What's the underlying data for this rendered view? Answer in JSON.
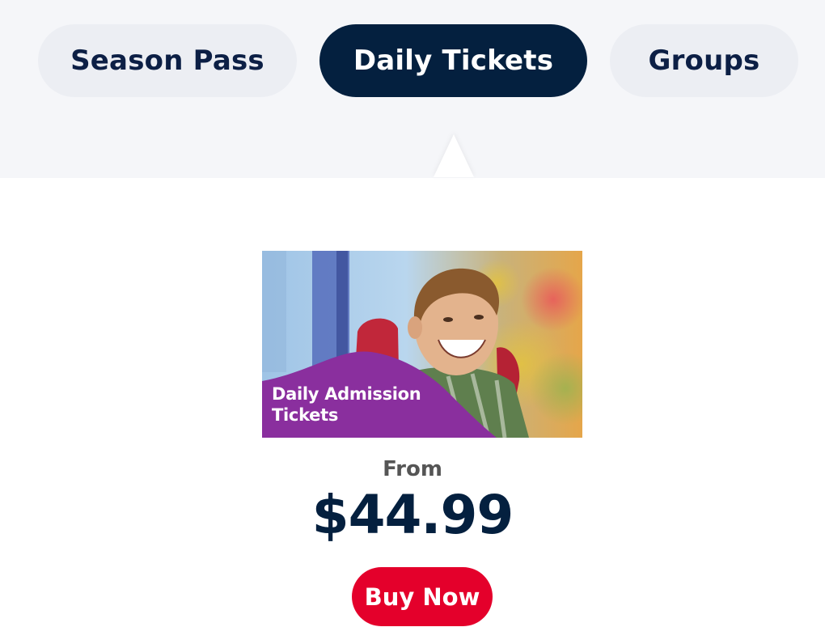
{
  "tabs": [
    {
      "label": "Season Pass",
      "active": false
    },
    {
      "label": "Daily Tickets",
      "active": true
    },
    {
      "label": "Groups",
      "active": false
    }
  ],
  "product": {
    "image_caption_line1": "Daily Admission",
    "image_caption_line2": "Tickets",
    "from_label": "From",
    "price": "$44.99",
    "buy_label": "Buy Now"
  },
  "colors": {
    "navy": "#04203f",
    "tab_inactive_bg": "#eceef3",
    "tab_bar_bg": "#f5f6f9",
    "buy_red": "#e4002b",
    "caption_purple": "#8a2f9e"
  }
}
